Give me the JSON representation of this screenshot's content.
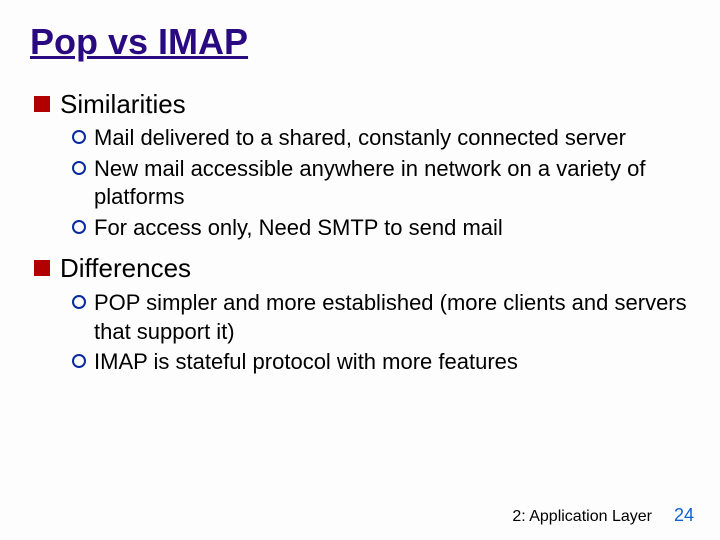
{
  "title": "Pop vs IMAP",
  "sections": {
    "0": {
      "heading": "Similarities",
      "items": {
        "0": "Mail delivered to a shared, constanly connected server",
        "1": "New mail accessible anywhere in network on a variety of platforms",
        "2": "For access only, Need SMTP to send mail"
      }
    },
    "1": {
      "heading": "Differences",
      "items": {
        "0": "POP simpler and more established (more clients and servers that support it)",
        "1": "IMAP is stateful protocol with more features"
      }
    }
  },
  "footer": {
    "label": "2: Application Layer",
    "page": "24"
  }
}
